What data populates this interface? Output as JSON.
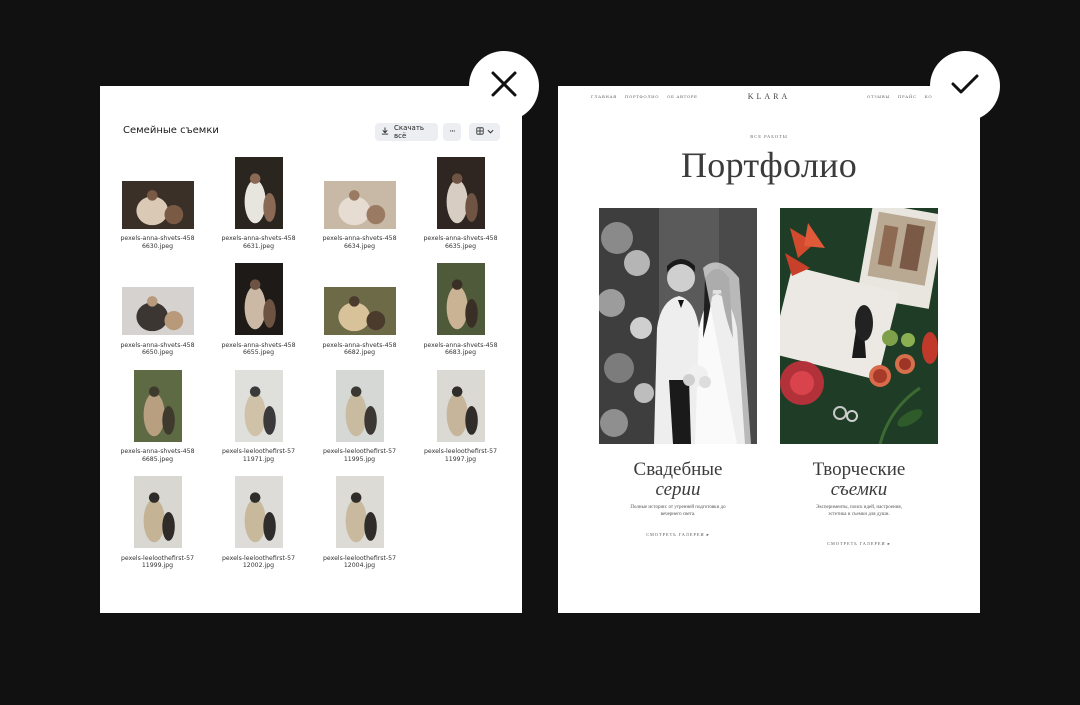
{
  "left_panel": {
    "title": "Семейные съемки",
    "download_label": "Скачать всё",
    "more_label": "···",
    "files": [
      {
        "name": "pexels-anna-shvets-458\n6630.jpeg",
        "orientation": "landscape",
        "palette": [
          "#3a3028",
          "#d9c9b5",
          "#7a5a45"
        ]
      },
      {
        "name": "pexels-anna-shvets-458\n6631.jpeg",
        "orientation": "portrait",
        "palette": [
          "#2b2520",
          "#e8e4de",
          "#8a6a55"
        ]
      },
      {
        "name": "pexels-anna-shvets-458\n6634.jpeg",
        "orientation": "landscape",
        "palette": [
          "#c8b8a6",
          "#e6dcd2",
          "#9a7a62"
        ]
      },
      {
        "name": "pexels-anna-shvets-458\n6635.jpeg",
        "orientation": "portrait",
        "palette": [
          "#2f2621",
          "#d8cdc2",
          "#6f5444"
        ]
      },
      {
        "name": "pexels-anna-shvets-458\n6650.jpeg",
        "orientation": "landscape",
        "palette": [
          "#d5d2cf",
          "#3c3632",
          "#b89a7a"
        ]
      },
      {
        "name": "pexels-anna-shvets-458\n6655.jpeg",
        "orientation": "portrait",
        "palette": [
          "#1e1a18",
          "#cbb9a6",
          "#6c5342"
        ]
      },
      {
        "name": "pexels-anna-shvets-458\n6682.jpeg",
        "orientation": "landscape",
        "palette": [
          "#6d6a48",
          "#d8c29a",
          "#4a3b2c"
        ]
      },
      {
        "name": "pexels-anna-shvets-458\n6683.jpeg",
        "orientation": "portrait",
        "palette": [
          "#4e5a3a",
          "#c9b394",
          "#3a2f26"
        ]
      },
      {
        "name": "pexels-anna-shvets-458\n6685.jpeg",
        "orientation": "portrait-narrow",
        "palette": [
          "#5d6a44",
          "#b89f7f",
          "#3f3a2e"
        ]
      },
      {
        "name": "pexels-leeloothefirst-57\n11971.jpg",
        "orientation": "portrait",
        "palette": [
          "#dfe0dc",
          "#cfc2a8",
          "#3a3a3a"
        ]
      },
      {
        "name": "pexels-leeloothefirst-57\n11995.jpg",
        "orientation": "portrait",
        "palette": [
          "#d6d8d6",
          "#c9bba0",
          "#3b3733"
        ]
      },
      {
        "name": "pexels-leeloothefirst-57\n11997.jpg",
        "orientation": "portrait",
        "palette": [
          "#dad9d4",
          "#c6b59a",
          "#2f2c29"
        ]
      },
      {
        "name": "pexels-leeloothefirst-57\n11999.jpg",
        "orientation": "portrait",
        "palette": [
          "#d8d7d2",
          "#c4b394",
          "#2e2b28"
        ]
      },
      {
        "name": "pexels-leeloothefirst-57\n12002.jpg",
        "orientation": "portrait",
        "palette": [
          "#dddcd8",
          "#c8b89c",
          "#2f2d2b"
        ]
      },
      {
        "name": "pexels-leeloothefirst-57\n12004.jpg",
        "orientation": "portrait",
        "palette": [
          "#dcdbd6",
          "#c9b99e",
          "#2f2c2a"
        ]
      }
    ]
  },
  "right_panel": {
    "nav_left": [
      "ГЛАВНАЯ",
      "ПОРТФОЛИО",
      "ОБ АВТОРЕ"
    ],
    "logo": "KLARA",
    "nav_right": [
      "ОТЗЫВЫ",
      "ПРАЙС",
      "КОНТ"
    ],
    "eyebrow": "ВСЕ РАБОТЫ",
    "title": "Портфолио",
    "cards": [
      {
        "title_line1": "Свадебные",
        "title_line2": "серии",
        "description": "Полные истории: от утренней подготовки до вечернего света.",
        "link": "СМОТРЕТЬ ГАЛЕРЕИ ▸"
      },
      {
        "title_line1": "Творческие",
        "title_line2": "съемки",
        "description": "Эксперименты, поиск идей, настроения, эстетика и съемки для души.",
        "link": "СМОТРЕТЬ ГАЛЕРЕИ ▸"
      }
    ]
  },
  "badges": {
    "reject_icon": "close-icon",
    "approve_icon": "check-icon"
  },
  "colors": {
    "background": "#111111",
    "panel": "#ffffff",
    "button_bg": "#eceef1",
    "heading": "#3b3b3b"
  }
}
